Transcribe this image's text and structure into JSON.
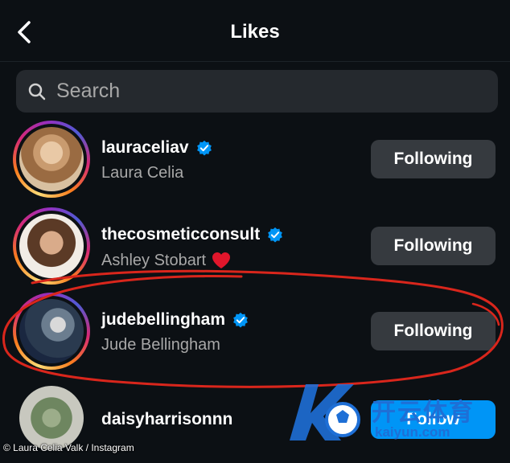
{
  "header": {
    "title": "Likes",
    "back_icon": "chevron-left-icon"
  },
  "search": {
    "placeholder": "Search",
    "icon": "search-icon"
  },
  "users": [
    {
      "username": "lauraceliav",
      "full_name": "Laura Celia",
      "verified": true,
      "story_ring": true,
      "button": "Following"
    },
    {
      "username": "thecosmeticconsult",
      "full_name": "Ashley Stobart",
      "full_name_emoji": "heart-icon",
      "verified": true,
      "story_ring": true,
      "button": "Following"
    },
    {
      "username": "judebellingham",
      "full_name": "Jude Bellingham",
      "verified": true,
      "story_ring": true,
      "button": "Following"
    },
    {
      "username": "daisyharrisonnn",
      "full_name": "",
      "verified": false,
      "story_ring": false,
      "button": "Follow"
    }
  ],
  "watermark": {
    "brand": "开云体育",
    "url": "kaiyun.com",
    "logo_letter": "K"
  },
  "caption": "© Laura Celia Valk / Instagram",
  "colors": {
    "background": "#0c1014",
    "verified": "#0095f6",
    "button": "#363a3f",
    "follow": "#0095f6",
    "annotation": "#d9261c",
    "heart": "#e0162b"
  }
}
